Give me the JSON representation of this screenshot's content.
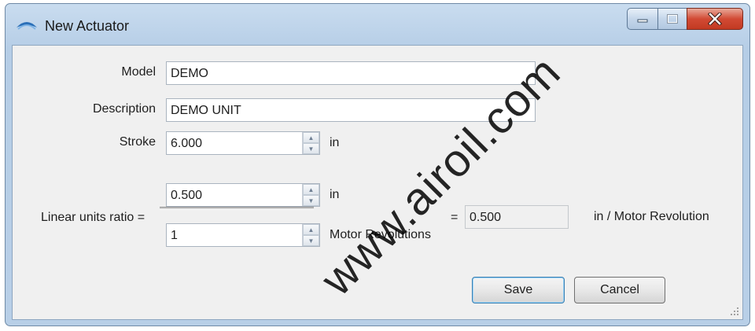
{
  "window": {
    "title": "New Actuator",
    "icon": "actuator-app-icon",
    "controls": {
      "minimize": "minimize-icon",
      "maximize": "maximize-icon",
      "close": "close-icon"
    }
  },
  "form": {
    "model": {
      "label": "Model",
      "value": "DEMO"
    },
    "description": {
      "label": "Description",
      "value": "DEMO UNIT"
    },
    "stroke": {
      "label": "Stroke",
      "value": "6.000",
      "unit": "in"
    },
    "ratio": {
      "label": "Linear units ratio =",
      "numerator": {
        "value": "0.500",
        "unit": "in"
      },
      "denominator": {
        "value": "1",
        "unit": "Motor Revolutions"
      },
      "equals": "=",
      "result": {
        "value": "0.500",
        "unit": "in / Motor Revolution"
      }
    }
  },
  "buttons": {
    "save": "Save",
    "cancel": "Cancel"
  },
  "watermark": "www.airoil.com",
  "colors": {
    "titlebar": "#b9d1ea",
    "client": "#f0f0f0",
    "close_button": "#c9432d"
  }
}
